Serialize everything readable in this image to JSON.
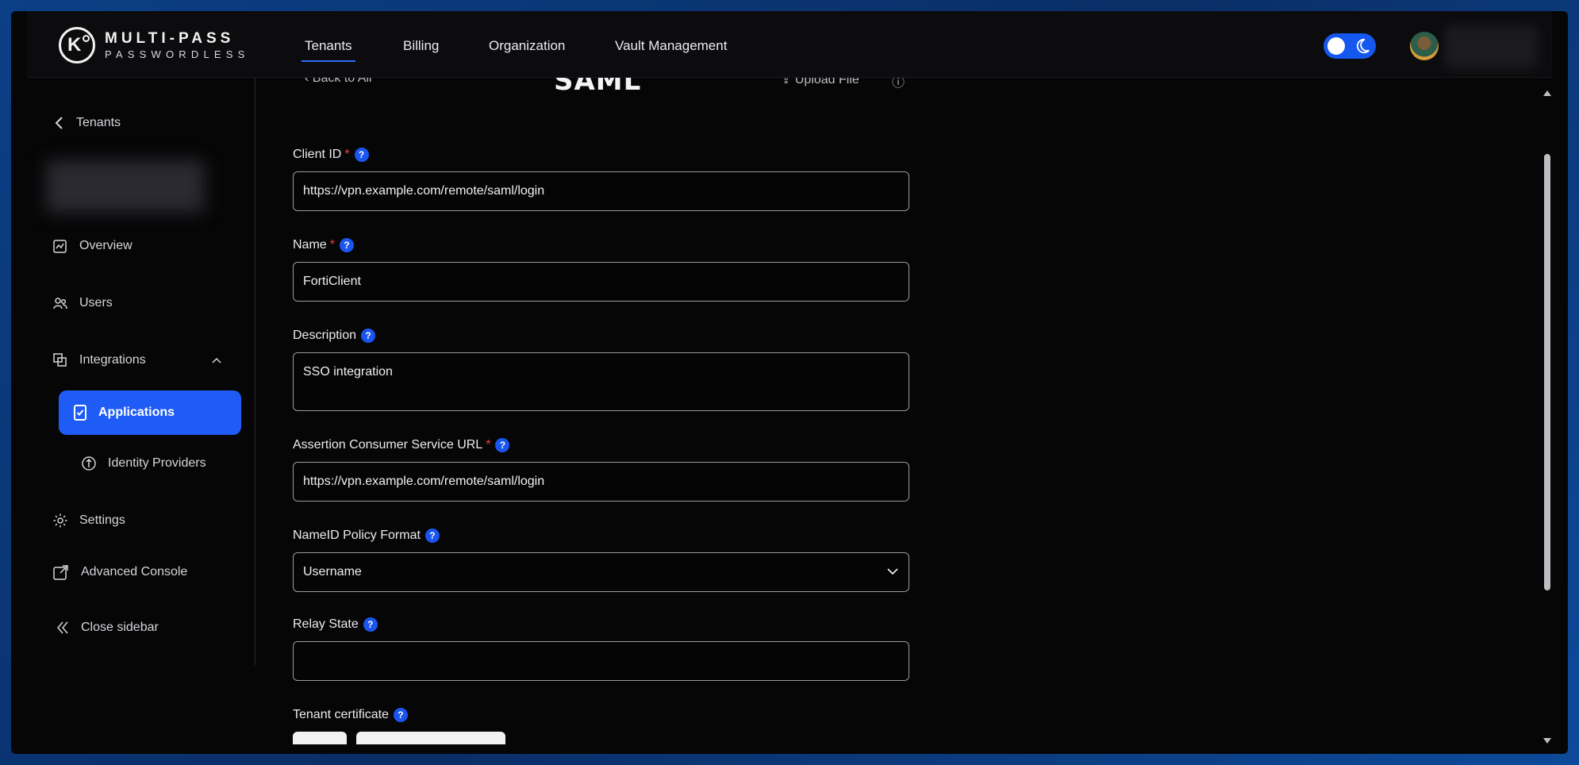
{
  "header": {
    "logo_title": "MULTI-PASS",
    "logo_sub": "PASSWORDLESS",
    "nav": [
      {
        "label": "Tenants",
        "active": true
      },
      {
        "label": "Billing",
        "active": false
      },
      {
        "label": "Organization",
        "active": false
      },
      {
        "label": "Vault Management",
        "active": false
      }
    ]
  },
  "sidebar": {
    "back_label": "Tenants",
    "items": {
      "overview": "Overview",
      "users": "Users",
      "integrations": "Integrations",
      "applications": "Applications",
      "identity_providers": "Identity Providers",
      "settings": "Settings",
      "advanced_console": "Advanced Console",
      "close_sidebar": "Close sidebar"
    }
  },
  "content": {
    "back_to_all": "Back to All",
    "saml_logo": "SAML",
    "upload_file": "Upload File",
    "fields": {
      "client_id": {
        "label": "Client ID",
        "value": "https://vpn.example.com/remote/saml/login"
      },
      "name": {
        "label": "Name",
        "value": "FortiClient"
      },
      "description": {
        "label": "Description",
        "value": "SSO integration"
      },
      "acs_url": {
        "label": "Assertion Consumer Service URL",
        "value": "https://vpn.example.com/remote/saml/login"
      },
      "nameid_policy": {
        "label": "NameID Policy Format",
        "value": "Username"
      },
      "relay_state": {
        "label": "Relay State",
        "value": ""
      },
      "tenant_certificate": {
        "label": "Tenant certificate"
      }
    }
  },
  "colors": {
    "accent": "#1f5cf5",
    "required": "#ff3b3b"
  }
}
